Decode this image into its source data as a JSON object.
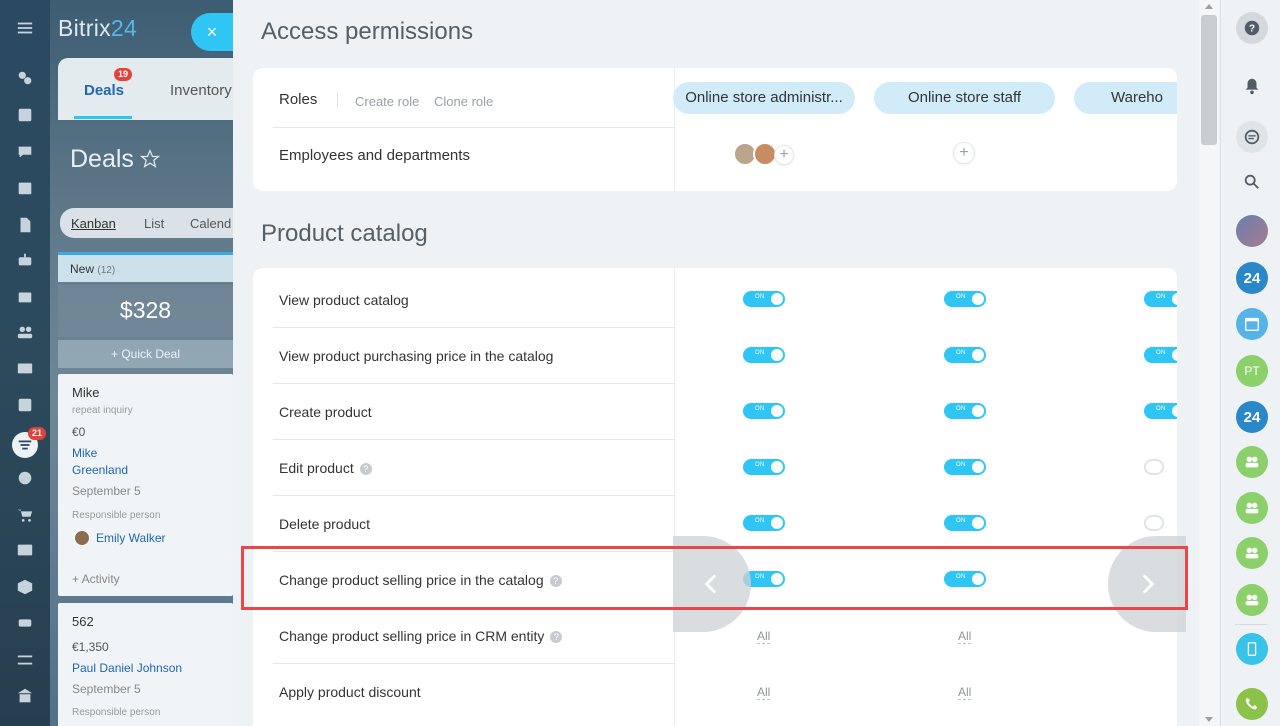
{
  "brand": {
    "name": "Bitrix",
    "num": "24"
  },
  "left_sidebar": {
    "deals_badge": "21"
  },
  "bg_app": {
    "tabs": {
      "deals": "Deals",
      "deals_badge": "19",
      "inventory": "Inventory"
    },
    "title": "Deals",
    "view_tabs": [
      "Kanban",
      "List",
      "Calend"
    ],
    "column": {
      "name": "New",
      "count": "(12)",
      "sum": "$328",
      "quick_deal": "+ Quick Deal"
    },
    "card1": {
      "name": "Mike",
      "sub": "repeat inquiry",
      "amount": "€0",
      "contact_line1": "Mike",
      "contact_line2": "Greenland",
      "date": "September 5",
      "responsible_label": "Responsible person",
      "responsible": "Emily Walker",
      "activity": "+ Activity"
    },
    "card2": {
      "name": "562",
      "amount": "€1,350",
      "contact": "Paul Daniel Johnson",
      "date": "September 5",
      "responsible_label": "Responsible person"
    }
  },
  "close": "×",
  "access": {
    "title": "Access permissions",
    "roles_label": "Roles",
    "create_role": "Create role",
    "clone_role": "Clone role",
    "roles": [
      "Online store administr...",
      "Online store staff",
      "Wareho"
    ],
    "employees_label": "Employees and departments"
  },
  "catalog": {
    "title": "Product catalog",
    "toggle_on_label": "ON",
    "all_label": "All",
    "rows": [
      {
        "label": "View product catalog"
      },
      {
        "label": "View product purchasing price in the catalog"
      },
      {
        "label": "Create product"
      },
      {
        "label": "Edit product"
      },
      {
        "label": "Delete product"
      },
      {
        "label": "Change product selling price in the catalog"
      },
      {
        "label": "Change product selling price in CRM entity"
      },
      {
        "label": "Apply product discount"
      }
    ]
  },
  "help_glyph": "?",
  "plus_glyph": "+",
  "right_sidebar": {
    "avatar_pt": "PT",
    "badge_24": "24"
  }
}
